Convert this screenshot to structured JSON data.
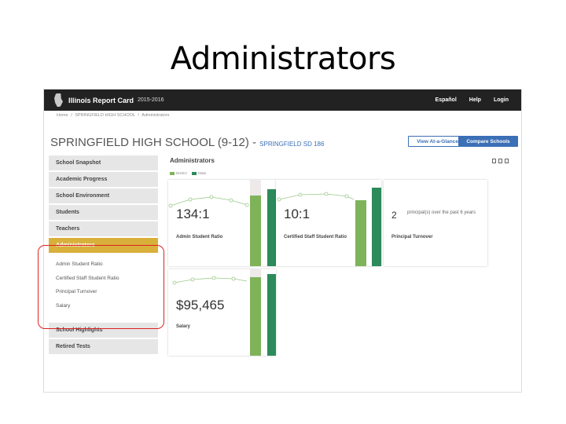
{
  "slide": {
    "title": "Administrators"
  },
  "topbar": {
    "app_title": "Illinois Report Card",
    "year": "2015-2016",
    "links": [
      "Español",
      "Help",
      "Login"
    ]
  },
  "breadcrumb": [
    "Home",
    "/",
    "SPRINGFIELD HIGH SCHOOL",
    "/",
    "Administrators"
  ],
  "school": {
    "name": "SPRINGFIELD HIGH SCHOOL (9-12)",
    "dash": "-",
    "district": "SPRINGFIELD SD 186"
  },
  "buttons": {
    "pdf": "View At-a-Glance PDF",
    "compare": "Compare Schools"
  },
  "sidebar": {
    "items_top": [
      "School Snapshot",
      "Academic Progress",
      "School Environment",
      "Students",
      "Teachers"
    ],
    "active": "Administrators",
    "sub_items": [
      "Admin Student Ratio",
      "Certified Staff Student Ratio",
      "Principal Turnover",
      "Salary"
    ],
    "items_bottom": [
      "School Highlights",
      "Retired Tests"
    ]
  },
  "section": {
    "title": "Administrators",
    "legend": [
      "District",
      "State"
    ]
  },
  "colors": {
    "district": "#7fb35a",
    "state": "#2c8a5b",
    "accent": "#d9b03a",
    "brand": "#3b6fb6"
  },
  "cards": {
    "admin_ratio": {
      "value": "134:1",
      "label": "Admin Student Ratio"
    },
    "staff_ratio": {
      "value": "10:1",
      "label": "Certified Staff Student Ratio"
    },
    "turnover": {
      "value": "2",
      "text": "principal(s) over the past 6 years",
      "label": "Principal Turnover"
    },
    "salary": {
      "value": "$95,465",
      "label": "Salary"
    }
  }
}
